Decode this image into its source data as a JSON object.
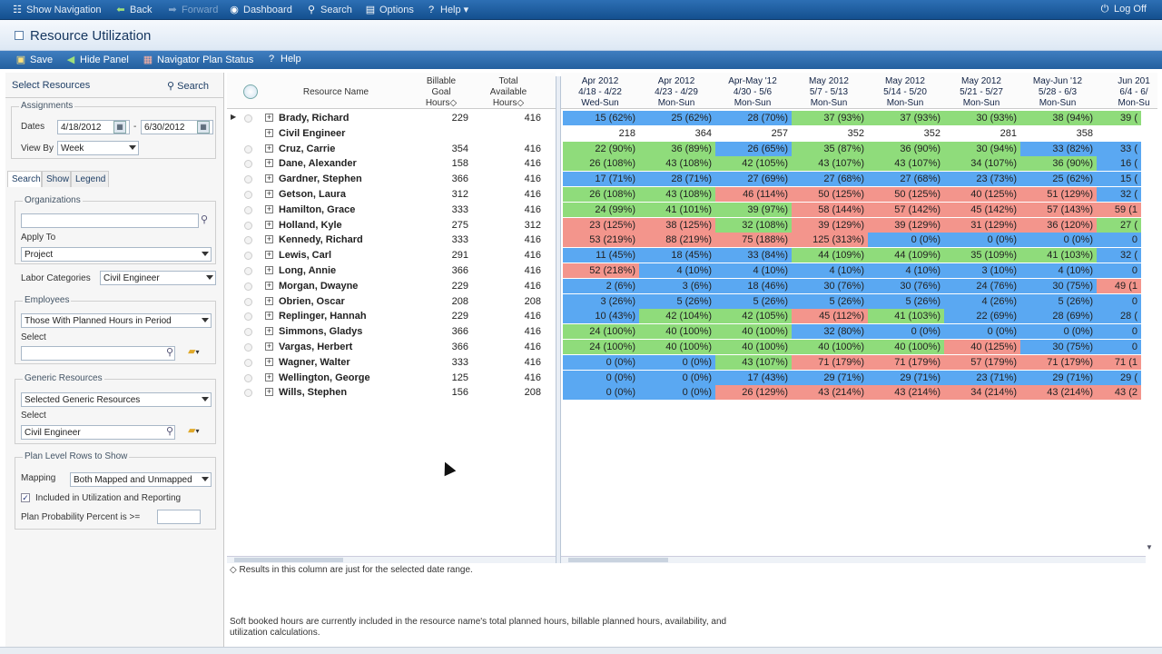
{
  "topbar": {
    "show_navigation": "Show Navigation",
    "back": "Back",
    "forward": "Forward",
    "dashboard": "Dashboard",
    "search": "Search",
    "options": "Options",
    "help": "Help",
    "logoff": "Log Off"
  },
  "page": {
    "title": "Resource Utilization"
  },
  "toolbar": {
    "save": "Save",
    "hide_panel": "Hide Panel",
    "navigator_plan_status": "Navigator Plan Status",
    "help": "Help"
  },
  "left": {
    "title": "Select Resources",
    "search": "Search",
    "assignments": {
      "legend": "Assignments",
      "dates_label": "Dates",
      "date_from": "4/18/2012",
      "date_sep": "-",
      "date_to": "6/30/2012",
      "view_by_label": "View By",
      "view_by": "Week"
    },
    "tabs": [
      "Search",
      "Show",
      "Legend"
    ],
    "organizations": {
      "legend": "Organizations",
      "value": "",
      "apply_to_label": "Apply To",
      "apply_to": "Project"
    },
    "labor_categories": {
      "label": "Labor Categories",
      "value": "Civil Engineer"
    },
    "employees": {
      "legend": "Employees",
      "value": "Those With Planned Hours in Period",
      "select_label": "Select",
      "select_value": ""
    },
    "generic_resources": {
      "legend": "Generic Resources",
      "value": "Selected Generic Resources",
      "select_label": "Select",
      "select_value": "Civil Engineer"
    },
    "plan_level": {
      "legend": "Plan Level Rows to Show",
      "mapping_label": "Mapping",
      "mapping": "Both Mapped and Unmapped",
      "included_label": "Included in Utilization and Reporting",
      "probability_label": "Plan Probability Percent is >="
    }
  },
  "grid": {
    "headers": {
      "resource_name": "Resource Name",
      "billable_goal": [
        "Billable",
        "Goal",
        "Hours◇"
      ],
      "total_available": [
        "Total",
        "Available",
        "Hours◇"
      ]
    },
    "periods": [
      {
        "l1": "Apr 2012",
        "l2": "4/18 - 4/22",
        "l3": "Wed-Sun"
      },
      {
        "l1": "Apr 2012",
        "l2": "4/23 - 4/29",
        "l3": "Mon-Sun"
      },
      {
        "l1": "Apr-May '12",
        "l2": "4/30 - 5/6",
        "l3": "Mon-Sun"
      },
      {
        "l1": "May 2012",
        "l2": "5/7 - 5/13",
        "l3": "Mon-Sun"
      },
      {
        "l1": "May 2012",
        "l2": "5/14 - 5/20",
        "l3": "Mon-Sun"
      },
      {
        "l1": "May 2012",
        "l2": "5/21 - 5/27",
        "l3": "Mon-Sun"
      },
      {
        "l1": "May-Jun '12",
        "l2": "5/28 - 6/3",
        "l3": "Mon-Sun"
      },
      {
        "l1": "Jun 201",
        "l2": "6/4 - 6/",
        "l3": "Mon-Su"
      }
    ],
    "rows": [
      {
        "name": "Brady, Richard",
        "goal": "229",
        "avail": "416",
        "cells": [
          [
            "15 (62%)",
            "b"
          ],
          [
            "25 (62%)",
            "b"
          ],
          [
            "28 (70%)",
            "b"
          ],
          [
            "37 (93%)",
            "g"
          ],
          [
            "37 (93%)",
            "g"
          ],
          [
            "30 (93%)",
            "g"
          ],
          [
            "38 (94%)",
            "g"
          ],
          [
            "39 (",
            "g"
          ]
        ]
      },
      {
        "name": "Civil Engineer",
        "goal": "",
        "avail": "",
        "cells": [
          [
            "218",
            "n"
          ],
          [
            "364",
            "n"
          ],
          [
            "257",
            "n"
          ],
          [
            "352",
            "n"
          ],
          [
            "352",
            "n"
          ],
          [
            "281",
            "n"
          ],
          [
            "358",
            "n"
          ],
          [
            "",
            "n"
          ]
        ]
      },
      {
        "name": "Cruz, Carrie",
        "goal": "354",
        "avail": "416",
        "cells": [
          [
            "22 (90%)",
            "g"
          ],
          [
            "36 (89%)",
            "g"
          ],
          [
            "26 (65%)",
            "b"
          ],
          [
            "35 (87%)",
            "g"
          ],
          [
            "36 (90%)",
            "g"
          ],
          [
            "30 (94%)",
            "g"
          ],
          [
            "33 (82%)",
            "b"
          ],
          [
            "33 (",
            "b"
          ]
        ]
      },
      {
        "name": "Dane, Alexander",
        "goal": "158",
        "avail": "416",
        "cells": [
          [
            "26 (108%)",
            "g"
          ],
          [
            "43 (108%)",
            "g"
          ],
          [
            "42 (105%)",
            "g"
          ],
          [
            "43 (107%)",
            "g"
          ],
          [
            "43 (107%)",
            "g"
          ],
          [
            "34 (107%)",
            "g"
          ],
          [
            "36 (90%)",
            "g"
          ],
          [
            "16 (",
            "b"
          ]
        ]
      },
      {
        "name": "Gardner, Stephen",
        "goal": "366",
        "avail": "416",
        "cells": [
          [
            "17 (71%)",
            "b"
          ],
          [
            "28 (71%)",
            "b"
          ],
          [
            "27 (69%)",
            "b"
          ],
          [
            "27 (68%)",
            "b"
          ],
          [
            "27 (68%)",
            "b"
          ],
          [
            "23 (73%)",
            "b"
          ],
          [
            "25 (62%)",
            "b"
          ],
          [
            "15 (",
            "b"
          ]
        ]
      },
      {
        "name": "Getson, Laura",
        "goal": "312",
        "avail": "416",
        "cells": [
          [
            "26 (108%)",
            "g"
          ],
          [
            "43 (108%)",
            "g"
          ],
          [
            "46 (114%)",
            "r"
          ],
          [
            "50 (125%)",
            "r"
          ],
          [
            "50 (125%)",
            "r"
          ],
          [
            "40 (125%)",
            "r"
          ],
          [
            "51 (129%)",
            "r"
          ],
          [
            "32 (",
            "b"
          ]
        ]
      },
      {
        "name": "Hamilton, Grace",
        "goal": "333",
        "avail": "416",
        "cells": [
          [
            "24 (99%)",
            "g"
          ],
          [
            "41 (101%)",
            "g"
          ],
          [
            "39 (97%)",
            "g"
          ],
          [
            "58 (144%)",
            "r"
          ],
          [
            "57 (142%)",
            "r"
          ],
          [
            "45 (142%)",
            "r"
          ],
          [
            "57 (143%)",
            "r"
          ],
          [
            "59 (1",
            "r"
          ]
        ]
      },
      {
        "name": "Holland, Kyle",
        "goal": "275",
        "avail": "312",
        "cells": [
          [
            "23 (125%)",
            "r"
          ],
          [
            "38 (125%)",
            "r"
          ],
          [
            "32 (108%)",
            "g"
          ],
          [
            "39 (129%)",
            "r"
          ],
          [
            "39 (129%)",
            "r"
          ],
          [
            "31 (129%)",
            "r"
          ],
          [
            "36 (120%)",
            "r"
          ],
          [
            "27 (",
            "g"
          ]
        ]
      },
      {
        "name": "Kennedy, Richard",
        "goal": "333",
        "avail": "416",
        "cells": [
          [
            "53 (219%)",
            "r"
          ],
          [
            "88 (219%)",
            "r"
          ],
          [
            "75 (188%)",
            "r"
          ],
          [
            "125 (313%)",
            "r"
          ],
          [
            "0 (0%)",
            "b"
          ],
          [
            "0 (0%)",
            "b"
          ],
          [
            "0 (0%)",
            "b"
          ],
          [
            "0",
            "b"
          ]
        ]
      },
      {
        "name": "Lewis, Carl",
        "goal": "291",
        "avail": "416",
        "cells": [
          [
            "11 (45%)",
            "b"
          ],
          [
            "18 (45%)",
            "b"
          ],
          [
            "33 (84%)",
            "b"
          ],
          [
            "44 (109%)",
            "g"
          ],
          [
            "44 (109%)",
            "g"
          ],
          [
            "35 (109%)",
            "g"
          ],
          [
            "41 (103%)",
            "g"
          ],
          [
            "32 (",
            "b"
          ]
        ]
      },
      {
        "name": "Long, Annie",
        "goal": "366",
        "avail": "416",
        "cells": [
          [
            "52 (218%)",
            "r"
          ],
          [
            "4 (10%)",
            "b"
          ],
          [
            "4 (10%)",
            "b"
          ],
          [
            "4 (10%)",
            "b"
          ],
          [
            "4 (10%)",
            "b"
          ],
          [
            "3 (10%)",
            "b"
          ],
          [
            "4 (10%)",
            "b"
          ],
          [
            "0",
            "b"
          ]
        ]
      },
      {
        "name": "Morgan, Dwayne",
        "goal": "229",
        "avail": "416",
        "cells": [
          [
            "2 (6%)",
            "b"
          ],
          [
            "3 (6%)",
            "b"
          ],
          [
            "18 (46%)",
            "b"
          ],
          [
            "30 (76%)",
            "b"
          ],
          [
            "30 (76%)",
            "b"
          ],
          [
            "24 (76%)",
            "b"
          ],
          [
            "30 (75%)",
            "b"
          ],
          [
            "49 (1",
            "r"
          ]
        ]
      },
      {
        "name": "Obrien, Oscar",
        "goal": "208",
        "avail": "208",
        "cells": [
          [
            "3 (26%)",
            "b"
          ],
          [
            "5 (26%)",
            "b"
          ],
          [
            "5 (26%)",
            "b"
          ],
          [
            "5 (26%)",
            "b"
          ],
          [
            "5 (26%)",
            "b"
          ],
          [
            "4 (26%)",
            "b"
          ],
          [
            "5 (26%)",
            "b"
          ],
          [
            "0",
            "b"
          ]
        ]
      },
      {
        "name": "Replinger, Hannah",
        "goal": "229",
        "avail": "416",
        "cells": [
          [
            "10 (43%)",
            "b"
          ],
          [
            "42 (104%)",
            "g"
          ],
          [
            "42 (105%)",
            "g"
          ],
          [
            "45 (112%)",
            "r"
          ],
          [
            "41 (103%)",
            "g"
          ],
          [
            "22 (69%)",
            "b"
          ],
          [
            "28 (69%)",
            "b"
          ],
          [
            "28 (",
            "b"
          ]
        ]
      },
      {
        "name": "Simmons, Gladys",
        "goal": "366",
        "avail": "416",
        "cells": [
          [
            "24 (100%)",
            "g"
          ],
          [
            "40 (100%)",
            "g"
          ],
          [
            "40 (100%)",
            "g"
          ],
          [
            "32 (80%)",
            "b"
          ],
          [
            "0 (0%)",
            "b"
          ],
          [
            "0 (0%)",
            "b"
          ],
          [
            "0 (0%)",
            "b"
          ],
          [
            "0",
            "b"
          ]
        ]
      },
      {
        "name": "Vargas, Herbert",
        "goal": "366",
        "avail": "416",
        "cells": [
          [
            "24 (100%)",
            "g"
          ],
          [
            "40 (100%)",
            "g"
          ],
          [
            "40 (100%)",
            "g"
          ],
          [
            "40 (100%)",
            "g"
          ],
          [
            "40 (100%)",
            "g"
          ],
          [
            "40 (125%)",
            "r"
          ],
          [
            "30 (75%)",
            "b"
          ],
          [
            "0",
            "b"
          ]
        ]
      },
      {
        "name": "Wagner, Walter",
        "goal": "333",
        "avail": "416",
        "cells": [
          [
            "0 (0%)",
            "b"
          ],
          [
            "0 (0%)",
            "b"
          ],
          [
            "43 (107%)",
            "g"
          ],
          [
            "71 (179%)",
            "r"
          ],
          [
            "71 (179%)",
            "r"
          ],
          [
            "57 (179%)",
            "r"
          ],
          [
            "71 (179%)",
            "r"
          ],
          [
            "71 (1",
            "r"
          ]
        ]
      },
      {
        "name": "Wellington, George",
        "goal": "125",
        "avail": "416",
        "cells": [
          [
            "0 (0%)",
            "b"
          ],
          [
            "0 (0%)",
            "b"
          ],
          [
            "17 (43%)",
            "b"
          ],
          [
            "29 (71%)",
            "b"
          ],
          [
            "29 (71%)",
            "b"
          ],
          [
            "23 (71%)",
            "b"
          ],
          [
            "29 (71%)",
            "b"
          ],
          [
            "29 (",
            "b"
          ]
        ]
      },
      {
        "name": "Wills, Stephen",
        "goal": "156",
        "avail": "208",
        "cells": [
          [
            "0 (0%)",
            "b"
          ],
          [
            "0 (0%)",
            "b"
          ],
          [
            "26 (129%)",
            "r"
          ],
          [
            "43 (214%)",
            "r"
          ],
          [
            "43 (214%)",
            "r"
          ],
          [
            "34 (214%)",
            "r"
          ],
          [
            "43 (214%)",
            "r"
          ],
          [
            "43 (2",
            "r"
          ]
        ]
      }
    ]
  },
  "notes": {
    "results_note": "◇ Results in this column are just for the selected date range.",
    "soft_booked_1": "Soft booked hours are currently included in the resource name's total planned hours, billable planned hours, availability, and",
    "soft_booked_2": "utilization calculations."
  },
  "colors": {
    "green": "#8fdc7b",
    "blue": "#5aa8f2",
    "red": "#f3958c",
    "nav": "#1f5a9c"
  }
}
